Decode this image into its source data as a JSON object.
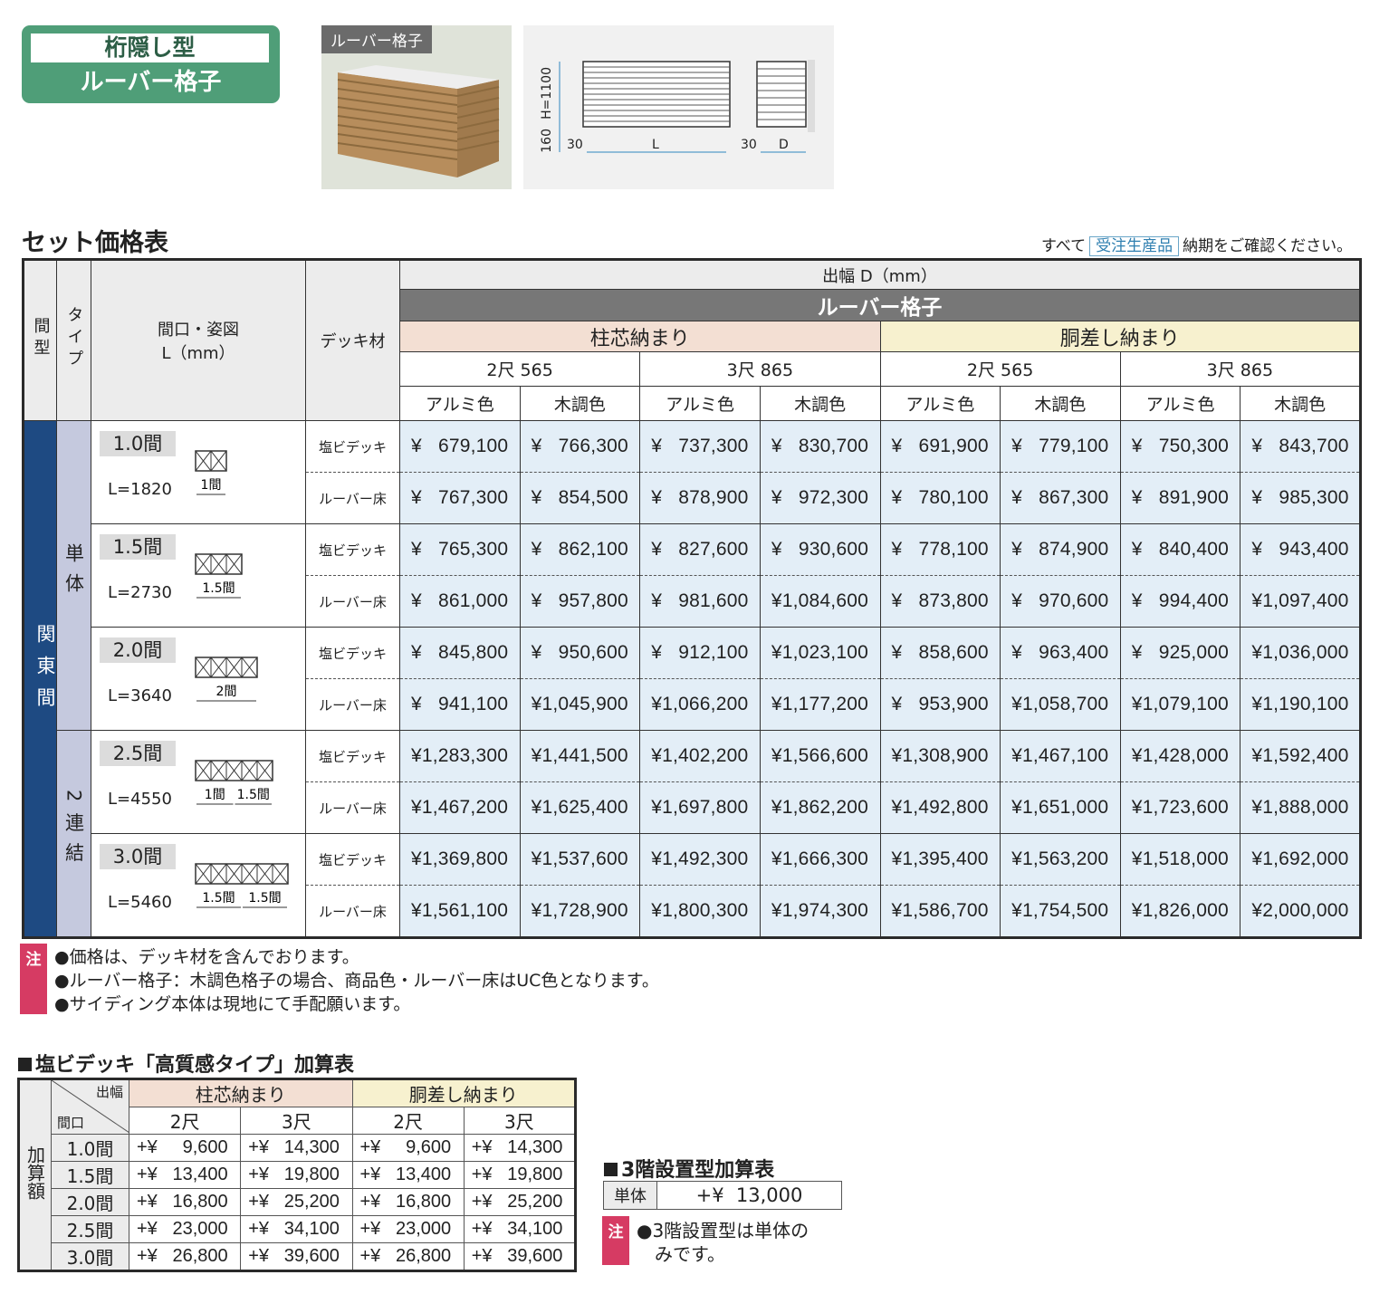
{
  "badge": {
    "line1": "桁隠し型",
    "line2": "ルーバー格子"
  },
  "photo_label": "ルーバー格子",
  "dimensions": {
    "h": "H=1100",
    "base": "160",
    "w30a": "30",
    "l": "L",
    "w30b": "30",
    "d": "D"
  },
  "section_title": "セット価格表",
  "top_note": {
    "pre": "すべて",
    "tag": "受注生産品",
    "post": "納期をご確認ください。"
  },
  "headers": {
    "kanma": "間型",
    "type": "タイプ",
    "maguchi": "間口・姿図",
    "maguchi_unit": "L（mm）",
    "deck": "デッキ材",
    "depth": "出幅 D（mm）",
    "product": "ルーバー格子",
    "group1": "柱芯納まり",
    "group2": "胴差し納まり",
    "sizes": [
      "2尺 565",
      "3尺 865",
      "2尺 565",
      "3尺 865"
    ],
    "colors": [
      "アルミ色",
      "木調色",
      "アルミ色",
      "木調色",
      "アルミ色",
      "木調色",
      "アルミ色",
      "木調色"
    ]
  },
  "region": "関東間",
  "type_single": "単体",
  "type_double": "2連結",
  "rows": [
    {
      "ma": "1.0間",
      "L": "L=1820",
      "tags": [
        "1間"
      ],
      "deck": [
        {
          "name": "塩ビデッキ",
          "prices": [
            "¥   679,100",
            "¥   766,300",
            "¥   737,300",
            "¥   830,700",
            "¥   691,900",
            "¥   779,100",
            "¥   750,300",
            "¥   843,700"
          ]
        },
        {
          "name": "ルーバー床",
          "prices": [
            "¥   767,300",
            "¥   854,500",
            "¥   878,900",
            "¥   972,300",
            "¥   780,100",
            "¥   867,300",
            "¥   891,900",
            "¥   985,300"
          ]
        }
      ]
    },
    {
      "ma": "1.5間",
      "L": "L=2730",
      "tags": [
        "1.5間"
      ],
      "deck": [
        {
          "name": "塩ビデッキ",
          "prices": [
            "¥   765,300",
            "¥   862,100",
            "¥   827,600",
            "¥   930,600",
            "¥   778,100",
            "¥   874,900",
            "¥   840,400",
            "¥   943,400"
          ]
        },
        {
          "name": "ルーバー床",
          "prices": [
            "¥   861,000",
            "¥   957,800",
            "¥   981,600",
            "¥1,084,600",
            "¥   873,800",
            "¥   970,600",
            "¥   994,400",
            "¥1,097,400"
          ]
        }
      ]
    },
    {
      "ma": "2.0間",
      "L": "L=3640",
      "tags": [
        "2間"
      ],
      "deck": [
        {
          "name": "塩ビデッキ",
          "prices": [
            "¥   845,800",
            "¥   950,600",
            "¥   912,100",
            "¥1,023,100",
            "¥   858,600",
            "¥   963,400",
            "¥   925,000",
            "¥1,036,000"
          ]
        },
        {
          "name": "ルーバー床",
          "prices": [
            "¥   941,100",
            "¥1,045,900",
            "¥1,066,200",
            "¥1,177,200",
            "¥   953,900",
            "¥1,058,700",
            "¥1,079,100",
            "¥1,190,100"
          ]
        }
      ]
    },
    {
      "ma": "2.5間",
      "L": "L=4550",
      "tags": [
        "1間",
        "1.5間"
      ],
      "deck": [
        {
          "name": "塩ビデッキ",
          "prices": [
            "¥1,283,300",
            "¥1,441,500",
            "¥1,402,200",
            "¥1,566,600",
            "¥1,308,900",
            "¥1,467,100",
            "¥1,428,000",
            "¥1,592,400"
          ]
        },
        {
          "name": "ルーバー床",
          "prices": [
            "¥1,467,200",
            "¥1,625,400",
            "¥1,697,800",
            "¥1,862,200",
            "¥1,492,800",
            "¥1,651,000",
            "¥1,723,600",
            "¥1,888,000"
          ]
        }
      ]
    },
    {
      "ma": "3.0間",
      "L": "L=5460",
      "tags": [
        "1.5間",
        "1.5間"
      ],
      "deck": [
        {
          "name": "塩ビデッキ",
          "prices": [
            "¥1,369,800",
            "¥1,537,600",
            "¥1,492,300",
            "¥1,666,300",
            "¥1,395,400",
            "¥1,563,200",
            "¥1,518,000",
            "¥1,692,000"
          ]
        },
        {
          "name": "ルーバー床",
          "prices": [
            "¥1,561,100",
            "¥1,728,900",
            "¥1,800,300",
            "¥1,974,300",
            "¥1,586,700",
            "¥1,754,500",
            "¥1,826,000",
            "¥2,000,000"
          ]
        }
      ]
    }
  ],
  "notes": {
    "mark": "注",
    "lines": [
      "●価格は、デッキ材を含んでおります。",
      "●ルーバー格子：木調色格子の場合、商品色・ルーバー床はUC色となります。",
      "●サイディング本体は現地にて手配願います。"
    ]
  },
  "add_table": {
    "title": "塩ビデッキ「高質感タイプ」加算表",
    "corner_top": "出幅",
    "corner_bottom": "間口",
    "side": "加算額",
    "group1": "柱芯納まり",
    "group2": "胴差し納まり",
    "sizes": [
      "2尺",
      "3尺",
      "2尺",
      "3尺"
    ],
    "rows": [
      {
        "ma": "1.0間",
        "vals": [
          "+¥     9,600",
          "+¥   14,300",
          "+¥     9,600",
          "+¥   14,300"
        ]
      },
      {
        "ma": "1.5間",
        "vals": [
          "+¥   13,400",
          "+¥   19,800",
          "+¥   13,400",
          "+¥   19,800"
        ]
      },
      {
        "ma": "2.0間",
        "vals": [
          "+¥   16,800",
          "+¥   25,200",
          "+¥   16,800",
          "+¥   25,200"
        ]
      },
      {
        "ma": "2.5間",
        "vals": [
          "+¥   23,000",
          "+¥   34,100",
          "+¥   23,000",
          "+¥   34,100"
        ]
      },
      {
        "ma": "3.0間",
        "vals": [
          "+¥   26,800",
          "+¥   39,600",
          "+¥   26,800",
          "+¥   39,600"
        ]
      }
    ]
  },
  "floor3": {
    "title": "3階設置型加算表",
    "label": "単体",
    "value": "+¥  13,000",
    "note_mark": "注",
    "note_line1": "●3階設置型は単体の",
    "note_line2": "　みです。"
  },
  "colors": {
    "green": "#4f9e78",
    "navy": "#1e4a82",
    "lavender": "#c5c9de",
    "price_bg": "#e3eef7",
    "pink": "#f3dfd3",
    "yellow": "#f7f1cf",
    "red_note": "#d63b63"
  }
}
